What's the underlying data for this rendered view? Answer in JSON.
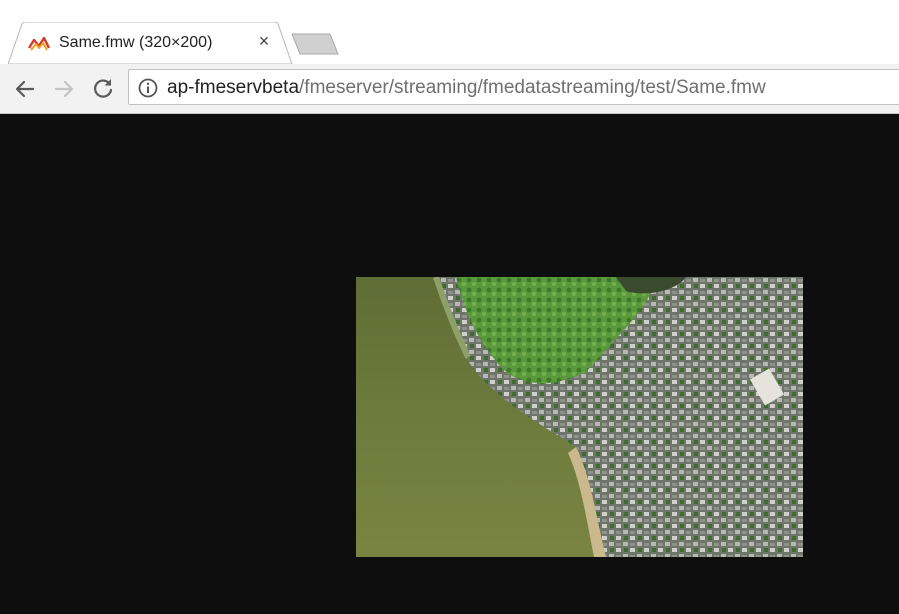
{
  "tab": {
    "title": "Same.fmw (320×200)",
    "favicon": "fme-logo-icon",
    "close_glyph": "×"
  },
  "toolbar": {
    "back_icon": "back-arrow-icon",
    "forward_icon": "forward-arrow-icon",
    "reload_icon": "reload-icon"
  },
  "omnibox": {
    "info_icon": "info-icon",
    "host": "ap-fmeservbeta",
    "path": "/fmeserver/streaming/fmedatastreaming/test/Same.fmw"
  },
  "content": {
    "image_label": "aerial-satellite-image",
    "background_color": "#0e0e0e"
  },
  "colors": {
    "water": "#6b7a3a",
    "vegetation": "#4e8a3a",
    "urban": "#8a8c86"
  }
}
